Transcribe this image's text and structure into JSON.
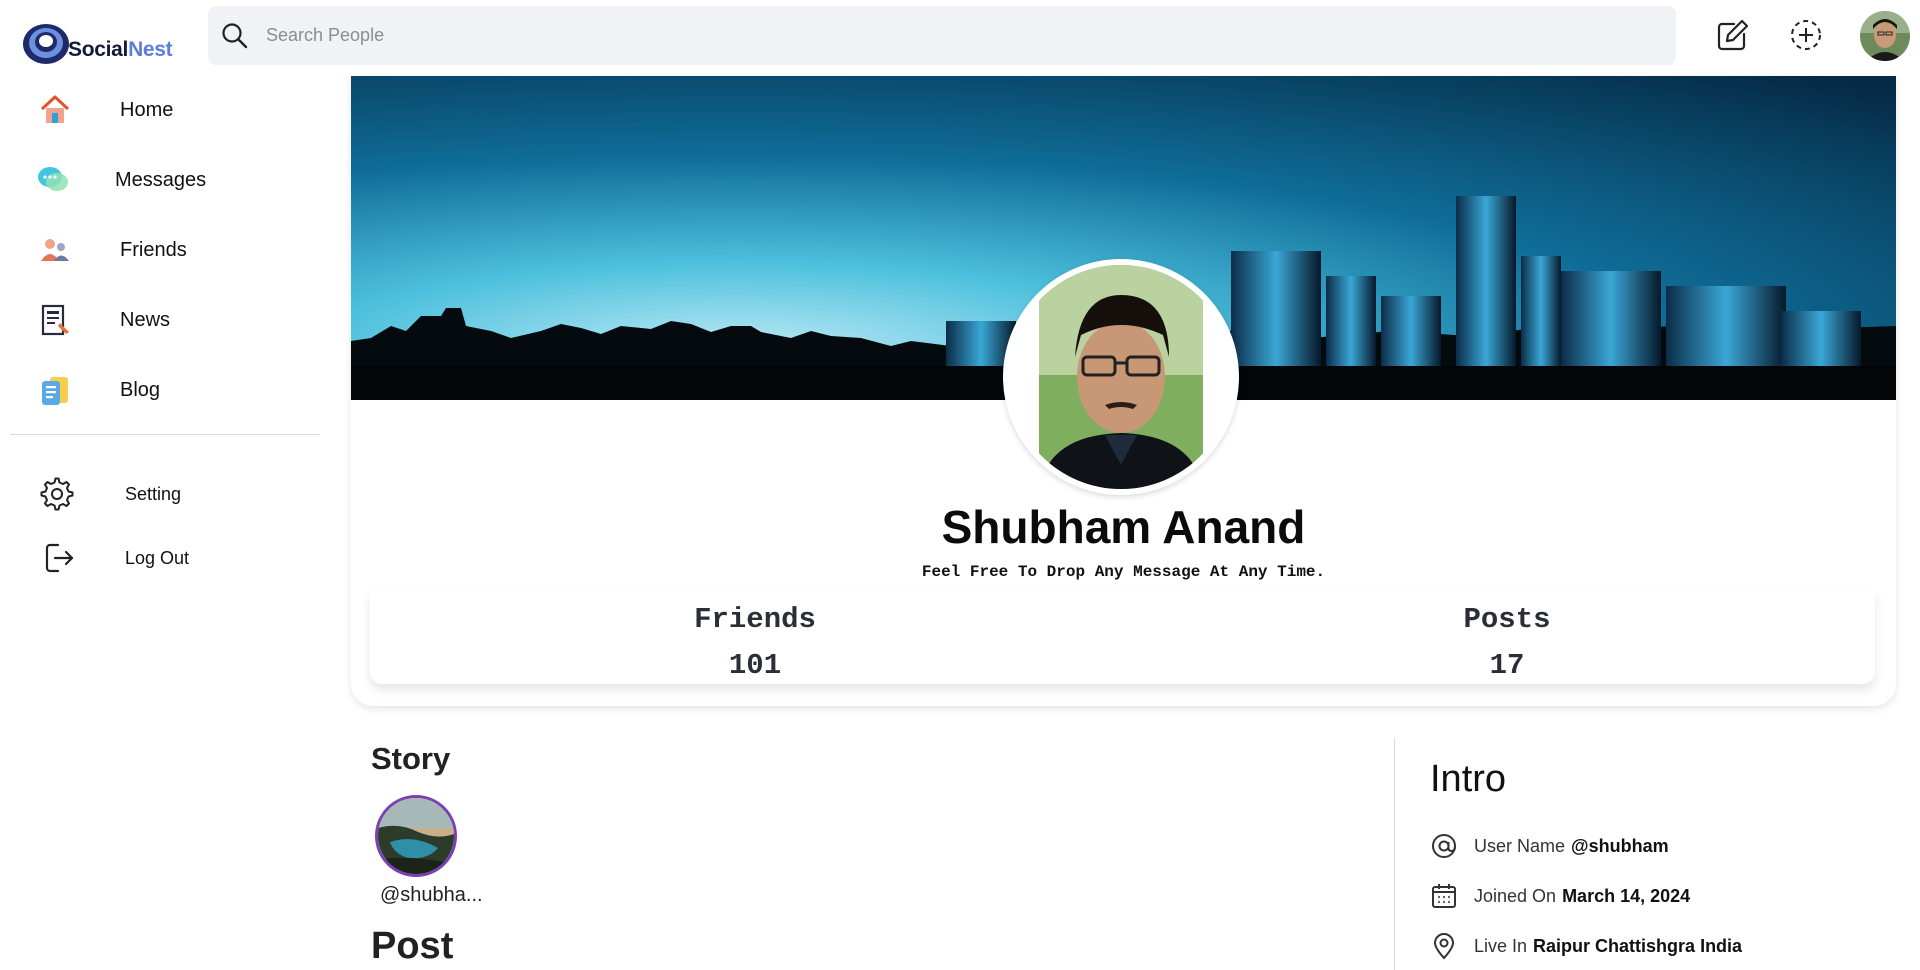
{
  "app": {
    "brand_part1": "Social",
    "brand_part2": "Nest"
  },
  "search": {
    "placeholder": "Search People"
  },
  "header_icons": [
    "edit-icon",
    "add-story-icon"
  ],
  "sidebar": {
    "items": [
      {
        "label": "Home",
        "icon": "home-icon"
      },
      {
        "label": "Messages",
        "icon": "messages-icon"
      },
      {
        "label": "Friends",
        "icon": "friends-icon"
      },
      {
        "label": "News",
        "icon": "news-icon"
      },
      {
        "label": "Blog",
        "icon": "blog-icon"
      }
    ],
    "bottom": [
      {
        "label": "Setting",
        "icon": "gear-icon"
      },
      {
        "label": "Log Out",
        "icon": "logout-icon"
      }
    ]
  },
  "profile": {
    "name": "Shubham Anand",
    "bio": "Feel Free To Drop Any Message At Any Time.",
    "stats": {
      "friends_label": "Friends",
      "friends_value": "101",
      "posts_label": "Posts",
      "posts_value": "17"
    }
  },
  "story": {
    "heading": "Story",
    "items": [
      {
        "user": "@shubha..."
      }
    ]
  },
  "post": {
    "heading": "Post"
  },
  "intro": {
    "heading": "Intro",
    "username_label": "User Name",
    "username_value": "@shubham",
    "joined_label": "Joined On",
    "joined_value": "March 14, 2024",
    "location_label": "Live In",
    "location_value": "Raipur Chattishgra India"
  },
  "colors": {
    "brand_dark": "#141a3a",
    "brand_accent": "#5b7fd6",
    "story_ring": "#7a3fb5"
  }
}
